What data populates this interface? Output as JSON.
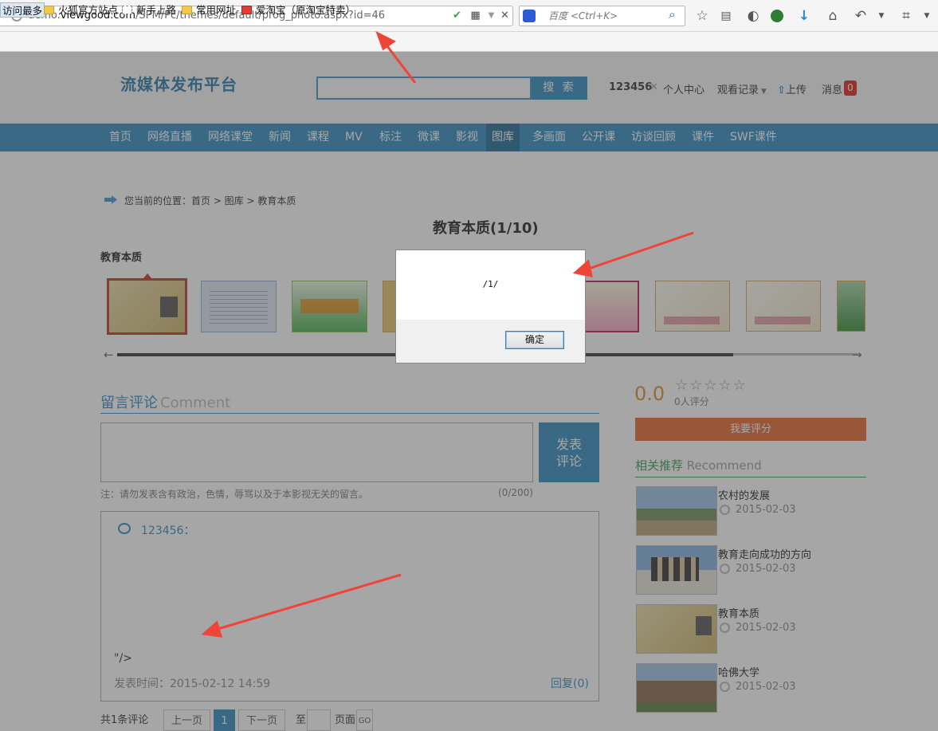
{
  "browser": {
    "url_prefix": "demo.",
    "url_domain": "viewgood.com",
    "url_path": "/SPM/Pc/themes/default/prog_photo.aspx?id=46",
    "search_placeholder": "百度 <Ctrl+K>",
    "bookmarks": [
      "访问最多",
      "火狐官方站点",
      "新手上路",
      "常用网址",
      "爱淘宝（原淘宝特卖）"
    ]
  },
  "header": {
    "logo": "流媒体发布平台",
    "search_button": "搜 索",
    "username": "123456",
    "close_mark": "✕",
    "personal_center": "个人中心",
    "watch_history": "观看记录",
    "upload": "上传",
    "messages": "消息",
    "message_count": "0"
  },
  "nav": {
    "items": [
      "首页",
      "网络直播",
      "网络课堂",
      "新闻",
      "课程",
      "MV",
      "标注",
      "微课",
      "影视",
      "图库",
      "多画面",
      "公开课",
      "访谈回顾",
      "课件",
      "SWF课件"
    ],
    "active": "图库"
  },
  "breadcrumb": "您当前的位置：首页 > 图库 > 教育本质",
  "photo": {
    "title": "教育本质(1/10)",
    "gallery_name": "教育本质"
  },
  "comments": {
    "heading": "留言评论",
    "heading_en": "Comment",
    "post_button_line1": "发表",
    "post_button_line2": "评论",
    "note": "注：请勿发表含有政治，色情，辱骂以及于本影视无关的留言。",
    "char_count": "(0/200)",
    "items": [
      {
        "user": "123456：",
        "text": "\"/>",
        "time": "发表时间：2015-02-12 14:59",
        "reply": "回复(0)"
      }
    ],
    "total": "共1条评论",
    "prev": "上一页",
    "current_page": "1",
    "next": "下一页",
    "to": "至",
    "page_unit": "页面",
    "go": "GO"
  },
  "rating": {
    "score": "0.0",
    "stars": "☆☆☆☆☆",
    "raters": "0人评分",
    "rate_button": "我要评分"
  },
  "recommend": {
    "heading": "相关推荐",
    "heading_en": "Recommend",
    "items": [
      {
        "title": "农村的发展",
        "date": "2015-02-03"
      },
      {
        "title": "教育走向成功的方向",
        "date": "2015-02-03"
      },
      {
        "title": "教育本质",
        "date": "2015-02-03"
      },
      {
        "title": "哈佛大学",
        "date": "2015-02-03"
      }
    ]
  },
  "dialog": {
    "message": "/1/",
    "ok_button": "确定"
  }
}
